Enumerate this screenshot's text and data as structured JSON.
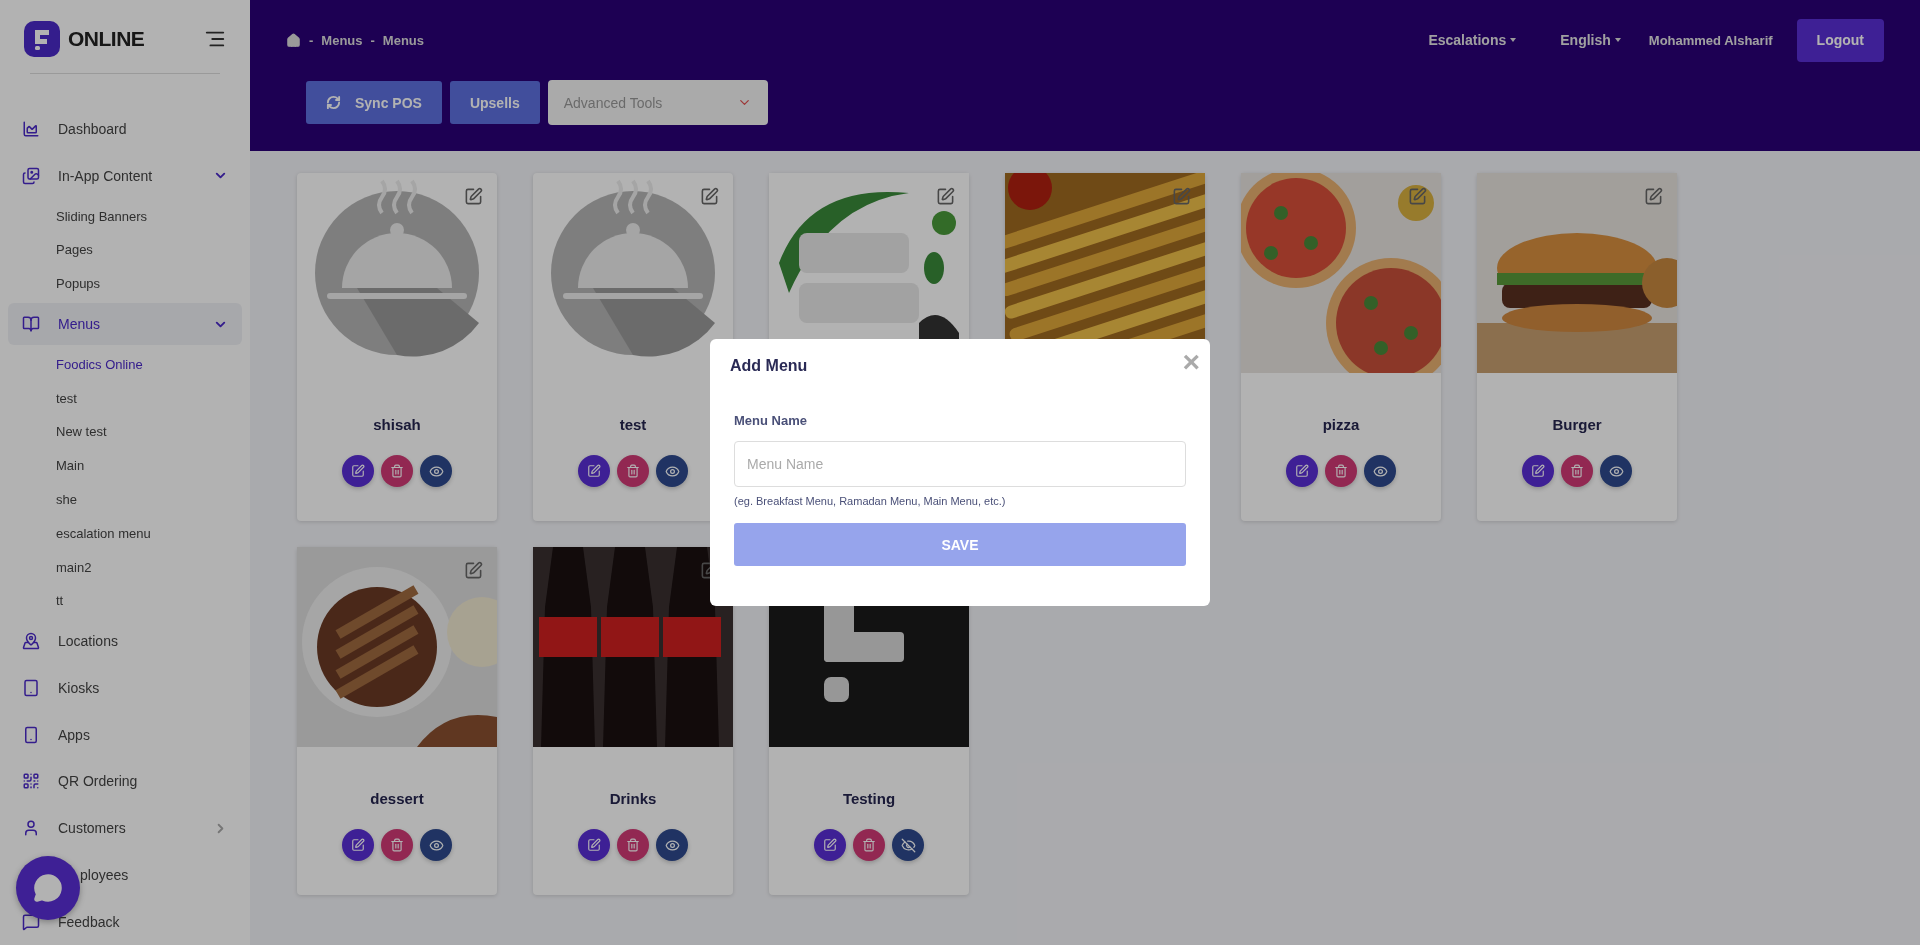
{
  "sidebar": {
    "logo_text": "ONLINE",
    "items": [
      {
        "label": "Dashboard",
        "selected": false
      },
      {
        "label": "In-App Content",
        "selected": false,
        "expanded": true,
        "children": [
          {
            "label": "Sliding Banners",
            "selected": false
          },
          {
            "label": "Pages",
            "selected": false
          },
          {
            "label": "Popups",
            "selected": false
          }
        ]
      },
      {
        "label": "Menus",
        "selected": true,
        "expanded": true,
        "children": [
          {
            "label": "Foodics Online",
            "selected": true
          },
          {
            "label": "test",
            "selected": false
          },
          {
            "label": "New test",
            "selected": false
          },
          {
            "label": "Main",
            "selected": false
          },
          {
            "label": "she",
            "selected": false
          },
          {
            "label": "escalation menu",
            "selected": false
          },
          {
            "label": "main2",
            "selected": false
          },
          {
            "label": "tt",
            "selected": false
          }
        ]
      },
      {
        "label": "Locations",
        "selected": false
      },
      {
        "label": "Kiosks",
        "selected": false
      },
      {
        "label": "Apps",
        "selected": false
      },
      {
        "label": "QR Ordering",
        "selected": false
      },
      {
        "label": "Customers",
        "selected": false,
        "expanded": false
      },
      {
        "label": "ployees",
        "selected": false,
        "kind": "covered"
      },
      {
        "label": "Feedback",
        "selected": false
      }
    ]
  },
  "breadcrumb": [
    {
      "separator": "-",
      "label": "Menus"
    },
    {
      "separator": "-",
      "label": "Menus"
    }
  ],
  "header_menu": [
    {
      "label": "Escalations",
      "kind": "dropdown"
    },
    {
      "label": "English",
      "kind": "dropdown"
    },
    {
      "label": "Mohammed Alsharif",
      "kind": "text"
    }
  ],
  "logout_button": "Logout",
  "toolbar": {
    "buttons": [
      {
        "label": "Sync POS",
        "kind": "sync"
      },
      {
        "label": "Upsells",
        "kind": "plain"
      }
    ],
    "select": {
      "placeholder": "Advanced Tools"
    }
  },
  "cards": [
    {
      "kind": "placeholder",
      "name": "shisah",
      "visible": true
    },
    {
      "kind": "placeholder",
      "name": "test",
      "visible": true
    },
    {
      "kind": "picture"
    },
    {
      "kind": "picture"
    },
    {
      "kind": "picture",
      "name": "pizza",
      "visible": true
    },
    {
      "kind": "picture",
      "name": "Burger",
      "visible": true
    },
    {
      "kind": "picture",
      "name": "dessert",
      "visible": true
    },
    {
      "kind": "picture",
      "name": "Drinks",
      "visible": true
    },
    {
      "kind": "logo",
      "name": "Testing",
      "visible": false
    }
  ],
  "dialog": {
    "title": "Add Menu",
    "close": "×",
    "field_label": "Menu Name",
    "placeholder": "Menu Name",
    "help": "(eg. Breakfast Menu, Ramadan Menu, Main Menu, etc.)",
    "save": {
      "label": "SAVE",
      "disabled": true
    }
  }
}
